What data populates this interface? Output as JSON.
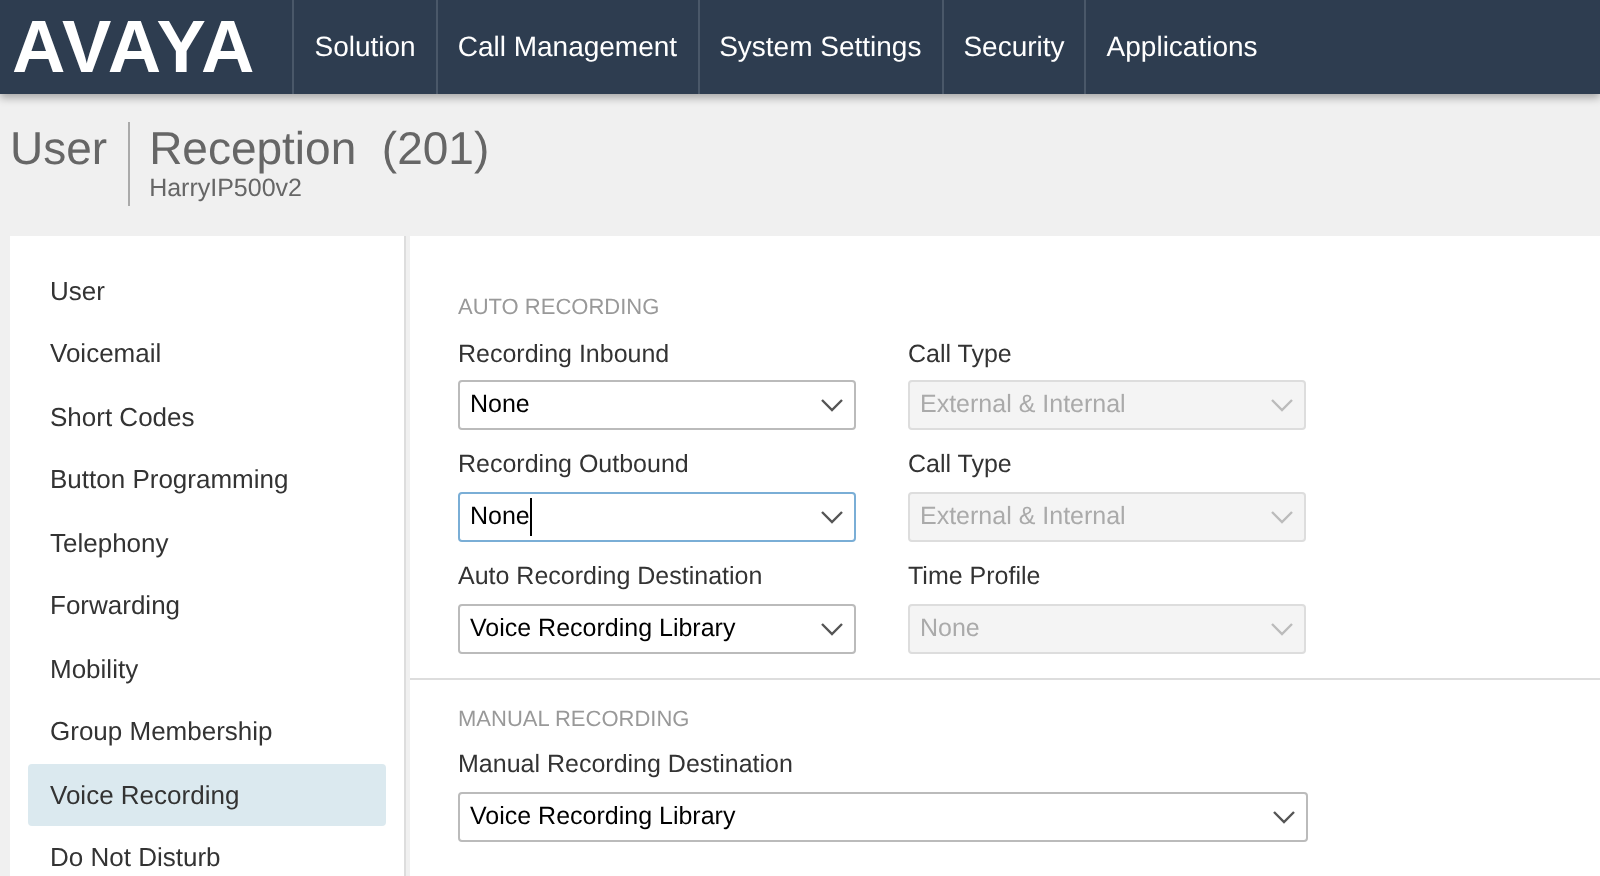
{
  "navbar": {
    "logo": "AVAYA",
    "items": [
      {
        "label": "Solution"
      },
      {
        "label": "Call Management"
      },
      {
        "label": "System Settings"
      },
      {
        "label": "Security"
      },
      {
        "label": "Applications"
      }
    ]
  },
  "header": {
    "section": "User",
    "title": "Reception",
    "number": "(201)",
    "subtitle": "HarryIP500v2"
  },
  "sidebar": {
    "items": [
      {
        "label": "User",
        "selected": false
      },
      {
        "label": "Voicemail",
        "selected": false
      },
      {
        "label": "Short Codes",
        "selected": false
      },
      {
        "label": "Button Programming",
        "selected": false
      },
      {
        "label": "Telephony",
        "selected": false
      },
      {
        "label": "Forwarding",
        "selected": false
      },
      {
        "label": "Mobility",
        "selected": false
      },
      {
        "label": "Group Membership",
        "selected": false
      },
      {
        "label": "Voice Recording",
        "selected": true
      },
      {
        "label": "Do Not Disturb",
        "selected": false
      }
    ]
  },
  "sections": [
    {
      "title": "AUTO RECORDING",
      "rows": [
        [
          {
            "label": "Recording Inbound",
            "value": "None",
            "disabled": false,
            "focused": false
          },
          {
            "label": "Call Type",
            "value": "External & Internal",
            "disabled": true,
            "focused": false
          }
        ],
        [
          {
            "label": "Recording Outbound",
            "value": "None",
            "disabled": false,
            "focused": true
          },
          {
            "label": "Call Type",
            "value": "External & Internal",
            "disabled": true,
            "focused": false
          }
        ],
        [
          {
            "label": "Auto Recording Destination",
            "value": "Voice Recording Library",
            "disabled": false,
            "focused": false
          },
          {
            "label": "Time Profile",
            "value": "None",
            "disabled": true,
            "focused": false
          }
        ]
      ]
    },
    {
      "title": "MANUAL RECORDING",
      "rows": [
        [
          {
            "label": "Manual Recording Destination",
            "value": "Voice Recording Library",
            "disabled": false,
            "focused": false,
            "kind": "wide"
          }
        ]
      ]
    }
  ]
}
